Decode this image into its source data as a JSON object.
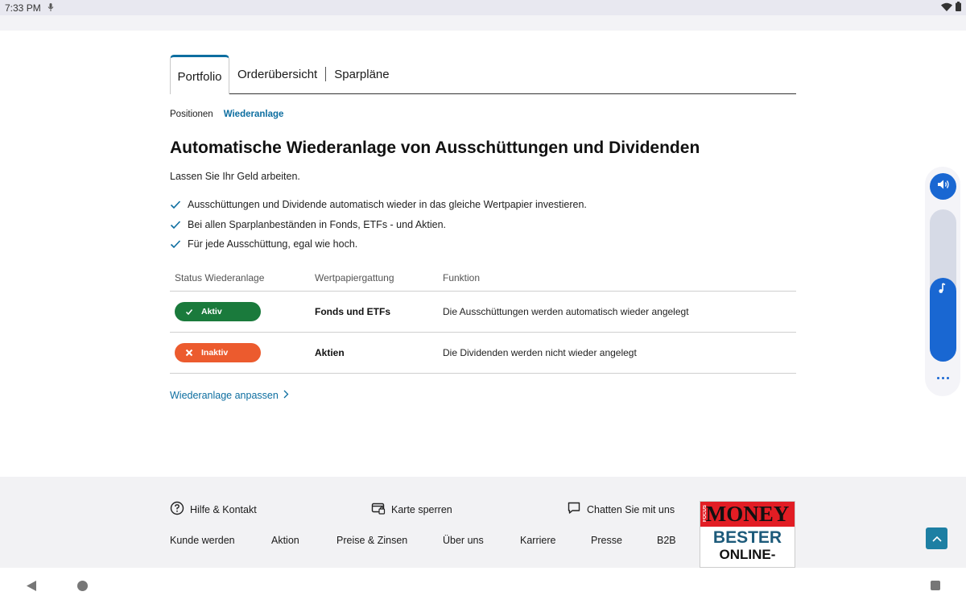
{
  "status_bar": {
    "time": "7:33 PM"
  },
  "tabs": [
    {
      "label": "Portfolio",
      "active": true
    },
    {
      "label": "Orderübersicht",
      "active": false
    },
    {
      "label": "Sparpläne",
      "active": false
    }
  ],
  "subnav": [
    {
      "label": "Positionen",
      "active": false
    },
    {
      "label": "Wiederanlage",
      "active": true
    }
  ],
  "page": {
    "title": "Automatische Wiederanlage von Ausschüttungen und Dividenden",
    "intro": "Lassen Sie Ihr Geld arbeiten.",
    "benefits": [
      "Ausschüttungen und Dividende automatisch wieder in das gleiche Wertpapier investieren.",
      "Bei allen Sparplanbeständen in Fonds, ETFs - und Aktien.",
      "Für jede Ausschüttung, egal wie hoch."
    ]
  },
  "table": {
    "headers": [
      "Status Wiederanlage",
      "Wertpapiergattung",
      "Funktion"
    ],
    "rows": [
      {
        "status": "Aktiv",
        "status_color": "#1a7a3c",
        "category": "Fonds und ETFs",
        "function": "Die Ausschüttungen werden automatisch wieder angelegt"
      },
      {
        "status": "Inaktiv",
        "status_color": "#ec5b2e",
        "category": "Aktien",
        "function": "Die Dividenden werden nicht wieder angelegt"
      }
    ]
  },
  "adjust_link": "Wiederanlage anpassen",
  "footer": {
    "help": "Hilfe & Kontakt",
    "block_card": "Karte sperren",
    "chat": "Chatten Sie mit uns",
    "nav": [
      "Kunde werden",
      "Aktion",
      "Preise & Zinsen",
      "Über uns",
      "Karriere",
      "Presse",
      "B2B"
    ],
    "award": {
      "brand": "MONEY",
      "publisher": "FOCUS",
      "line1": "BESTER",
      "line2": "ONLINE-"
    }
  },
  "volume_panel": {
    "level": 0.55
  },
  "colors": {
    "accent": "#0d6ea0",
    "active": "#1a7a3c",
    "inactive": "#ec5b2e",
    "system_blue": "#1967d2"
  }
}
